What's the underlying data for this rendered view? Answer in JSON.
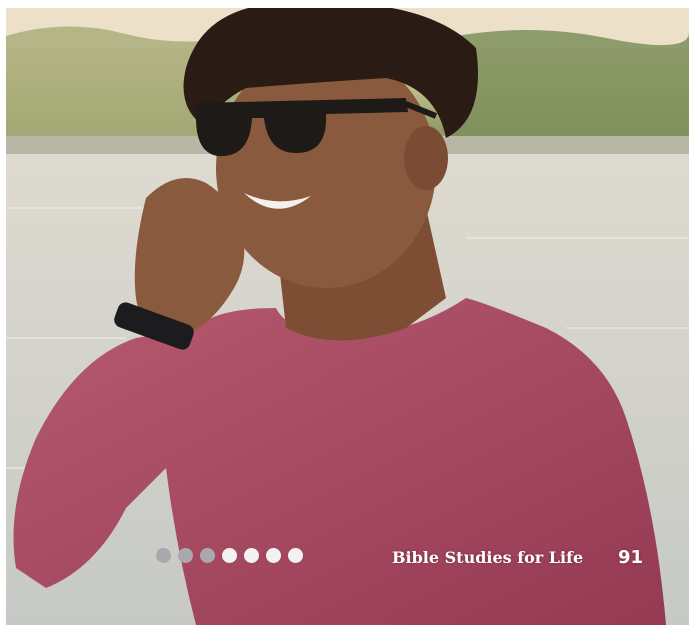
{
  "page": {
    "publication": "Bible Studies for Life",
    "page_number": "91"
  },
  "photo": {
    "subject": "man-on-phone-photo"
  },
  "progress_dots": {
    "count": 7,
    "filled": 3,
    "filled_color": "#a9a9ad",
    "empty_color": "#f2f2f2"
  },
  "colors": {
    "sweater": "#a8475f",
    "skin": "#8a5a3f",
    "hair": "#2a1c14"
  }
}
